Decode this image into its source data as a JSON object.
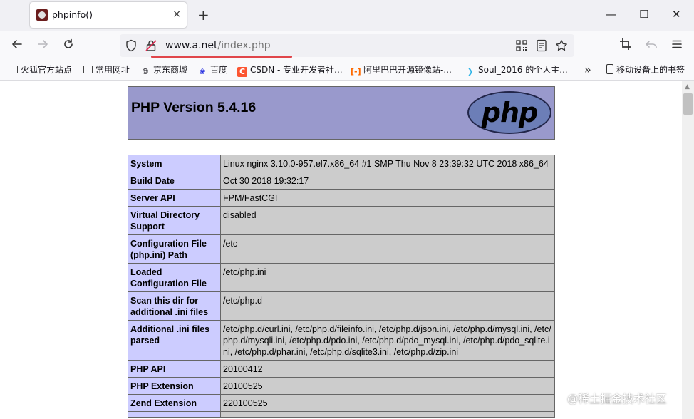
{
  "tab": {
    "title": "phpinfo()",
    "close_icon": "×"
  },
  "toolbar": {
    "new_tab": "+",
    "minimize": "—",
    "maximize": "☐",
    "close": "✕"
  },
  "url": {
    "host": "www.a.net",
    "path": "/index.php"
  },
  "bookmarks": [
    {
      "label": "火狐官方站点",
      "icon": "folder-icon"
    },
    {
      "label": "常用网址",
      "icon": "folder-icon"
    },
    {
      "label": "京东商城",
      "icon": "globe-icon"
    },
    {
      "label": "百度",
      "icon": "baidu-icon"
    },
    {
      "label": "CSDN - 专业开发者社...",
      "icon": "csdn-icon"
    },
    {
      "label": "阿里巴巴开源镜像站-...",
      "icon": "alibaba-icon"
    },
    {
      "label": "Soul_2016 的个人主...",
      "icon": "soul-icon"
    },
    {
      "label": "移动设备上的书签",
      "icon": "mobile-icon"
    }
  ],
  "php": {
    "version": "PHP Version 5.4.16",
    "logo_text": "php",
    "rows": [
      {
        "label": "System",
        "value": "Linux nginx 3.10.0-957.el7.x86_64 #1 SMP Thu Nov 8 23:39:32 UTC 2018 x86_64"
      },
      {
        "label": "Build Date",
        "value": "Oct 30 2018 19:32:17"
      },
      {
        "label": "Server API",
        "value": "FPM/FastCGI"
      },
      {
        "label": "Virtual Directory Support",
        "value": "disabled"
      },
      {
        "label": "Configuration File (php.ini) Path",
        "value": "/etc"
      },
      {
        "label": "Loaded Configuration File",
        "value": "/etc/php.ini"
      },
      {
        "label": "Scan this dir for additional .ini files",
        "value": "/etc/php.d"
      },
      {
        "label": "Additional .ini files parsed",
        "value": "/etc/php.d/curl.ini, /etc/php.d/fileinfo.ini, /etc/php.d/json.ini, /etc/php.d/mysql.ini, /etc/php.d/mysqli.ini, /etc/php.d/pdo.ini, /etc/php.d/pdo_mysql.ini, /etc/php.d/pdo_sqlite.ini, /etc/php.d/phar.ini, /etc/php.d/sqlite3.ini, /etc/php.d/zip.ini"
      },
      {
        "label": "PHP API",
        "value": "20100412"
      },
      {
        "label": "PHP Extension",
        "value": "20100525"
      },
      {
        "label": "Zend Extension",
        "value": "220100525"
      },
      {
        "label": "",
        "value": ""
      }
    ]
  },
  "watermark": "@稀土掘金技术社区"
}
